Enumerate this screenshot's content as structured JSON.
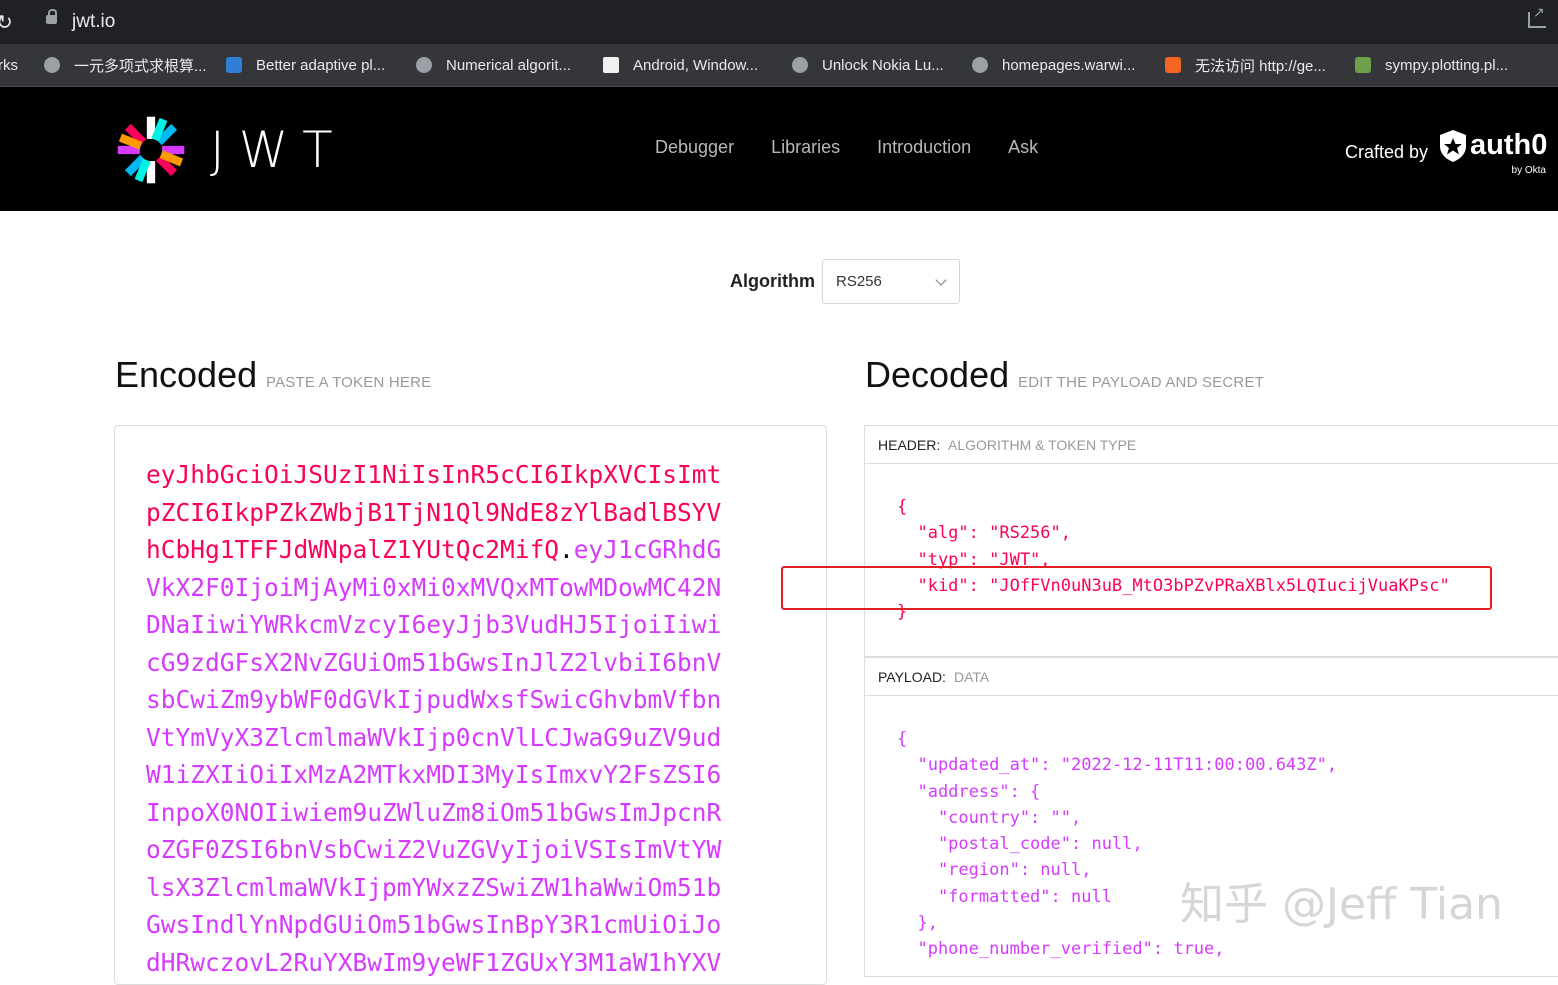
{
  "browser": {
    "url": "jwt.io",
    "bookmarks": [
      {
        "label": "rks",
        "icon": "none"
      },
      {
        "label": "一元多项式求根算...",
        "icon": "globe-icon"
      },
      {
        "label": "Better adaptive pl...",
        "icon": "site-icon"
      },
      {
        "label": "Numerical algorit...",
        "icon": "globe-icon"
      },
      {
        "label": "Android, Window...",
        "icon": "page-icon"
      },
      {
        "label": "Unlock Nokia Lu...",
        "icon": "globe-icon"
      },
      {
        "label": "homepages.warwi...",
        "icon": "globe-icon"
      },
      {
        "label": "无法访问 http://ge...",
        "icon": "blogger-icon"
      },
      {
        "label": "sympy.plotting.pl...",
        "icon": "python-icon"
      }
    ]
  },
  "nav": {
    "logo_text": "JWT",
    "links": [
      "Debugger",
      "Libraries",
      "Introduction",
      "Ask"
    ],
    "crafted_by": "Crafted by",
    "brand": "auth0",
    "brand_sub": "by Okta"
  },
  "algorithm": {
    "label": "Algorithm",
    "value": "RS256"
  },
  "encoded": {
    "title": "Encoded",
    "subtitle": "PASTE A TOKEN HERE",
    "lines": [
      [
        {
          "t": "eyJhbGciOiJSUzI1NiIsInR5cCI6IkpXVCIsImt",
          "c": "red"
        }
      ],
      [
        {
          "t": "pZCI6IkpPZkZWbjB1TjN1Ql9NdE8zYlBadlBSYV",
          "c": "red"
        }
      ],
      [
        {
          "t": "hCbHg1TFFJdWNpalZ1YUtQc2MifQ",
          "c": "red"
        },
        {
          "t": ".",
          "c": "dot"
        },
        {
          "t": "eyJ1cGRhdG",
          "c": "purple"
        }
      ],
      [
        {
          "t": "VkX2F0IjoiMjAyMi0xMi0xMVQxMTowMDowMC42N",
          "c": "purple"
        }
      ],
      [
        {
          "t": "DNaIiwiYWRkcmVzcyI6eyJjb3VudHJ5IjoiIiwi",
          "c": "purple"
        }
      ],
      [
        {
          "t": "cG9zdGFsX2NvZGUiOm51bGwsInJlZ2lvbiI6bnV",
          "c": "purple"
        }
      ],
      [
        {
          "t": "sbCwiZm9ybWF0dGVkIjpudWxsfSwicGhvbmVfbn",
          "c": "purple"
        }
      ],
      [
        {
          "t": "VtYmVyX3ZlcmlmaWVkIjp0cnVlLCJwaG9uZV9ud",
          "c": "purple"
        }
      ],
      [
        {
          "t": "W1iZXIiOiIxMzA2MTkxMDI3MyIsImxvY2FsZSI6",
          "c": "purple"
        }
      ],
      [
        {
          "t": "InpoX0NOIiwiem9uZWluZm8iOm51bGwsImJpcnR",
          "c": "purple"
        }
      ],
      [
        {
          "t": "oZGF0ZSI6bnVsbCwiZ2VuZGVyIjoiVSIsImVtYW",
          "c": "purple"
        }
      ],
      [
        {
          "t": "lsX3ZlcmlmaWVkIjpmYWxzZSwiZW1haWwiOm51b",
          "c": "purple"
        }
      ],
      [
        {
          "t": "GwsIndlYnNpdGUiOm51bGwsInBpY3R1cmUiOiJo",
          "c": "purple"
        }
      ],
      [
        {
          "t": "dHRwczovL2RuYXBwIm9yeWF1ZGUxY3M1aW1hYXV",
          "c": "purple"
        }
      ]
    ]
  },
  "decoded": {
    "title": "Decoded",
    "subtitle": "EDIT THE PAYLOAD AND SECRET",
    "header": {
      "label": "HEADER:",
      "sub": "ALGORITHM & TOKEN TYPE",
      "lines": [
        "{",
        "  \"alg\": \"RS256\",",
        "  \"typ\": \"JWT\",",
        "  \"kid\": \"JOfFVn0uN3uB_MtO3bPZvPRaXBlx5LQIucijVuaKPsc\"",
        "}"
      ]
    },
    "payload": {
      "label": "PAYLOAD:",
      "sub": "DATA",
      "lines": [
        "{",
        "  \"updated_at\": \"2022-12-11T11:00:00.643Z\",",
        "  \"address\": {",
        "    \"country\": \"\",",
        "    \"postal_code\": null,",
        "    \"region\": null,",
        "    \"formatted\": null",
        "  },",
        "  \"phone_number_verified\": true,"
      ]
    }
  },
  "watermark": "知乎 @Jeff Tian",
  "colors": {
    "header_json": "#fb015b",
    "payload_json": "#d63aff",
    "highlight_box": "#e02020"
  }
}
